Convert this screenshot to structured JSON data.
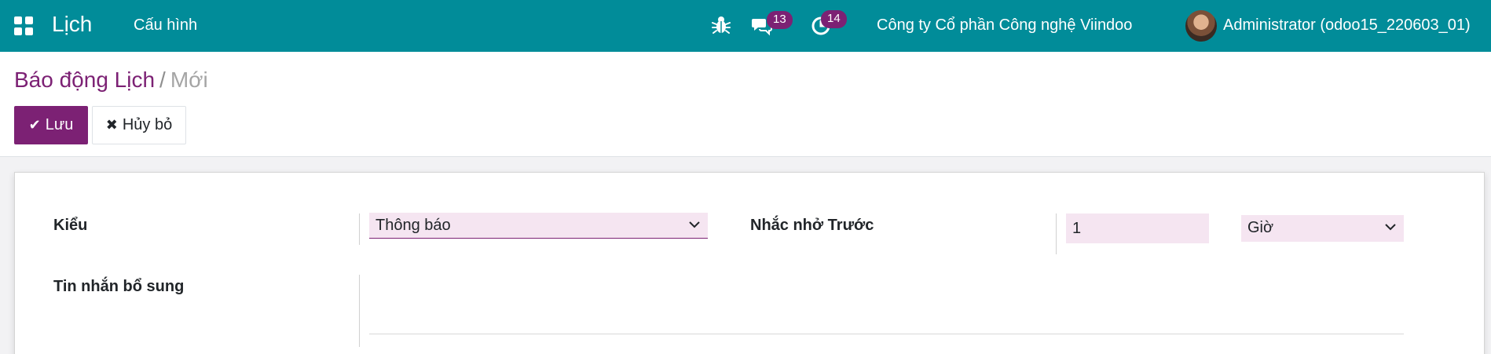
{
  "navbar": {
    "apps_icon": "apps-grid-icon",
    "app_name": "Lịch",
    "menu_config": "Cấu hình",
    "debug_icon": "bug-icon",
    "messages_icon": "chat-icon",
    "messages_count": "13",
    "activities_icon": "clock-icon",
    "activities_count": "14",
    "company": "Công ty Cổ phần Công nghệ Viindoo",
    "user": "Administrator (odoo15_220603_01)"
  },
  "breadcrumb": {
    "parent": "Báo động Lịch",
    "separator": "/",
    "current": "Mới"
  },
  "actions": {
    "save_label": "Lưu",
    "cancel_label": "Hủy bỏ"
  },
  "form": {
    "type_label": "Kiểu",
    "type_value": "Thông báo",
    "remind_label": "Nhắc nhở Trước",
    "remind_value": "1",
    "unit_value": "Giờ",
    "extra_message_label": "Tin nhắn bổ sung",
    "extra_message_value": ""
  },
  "colors": {
    "navbar": "#018c99",
    "primary": "#7c2174",
    "field_bg": "#f5e5f1"
  }
}
